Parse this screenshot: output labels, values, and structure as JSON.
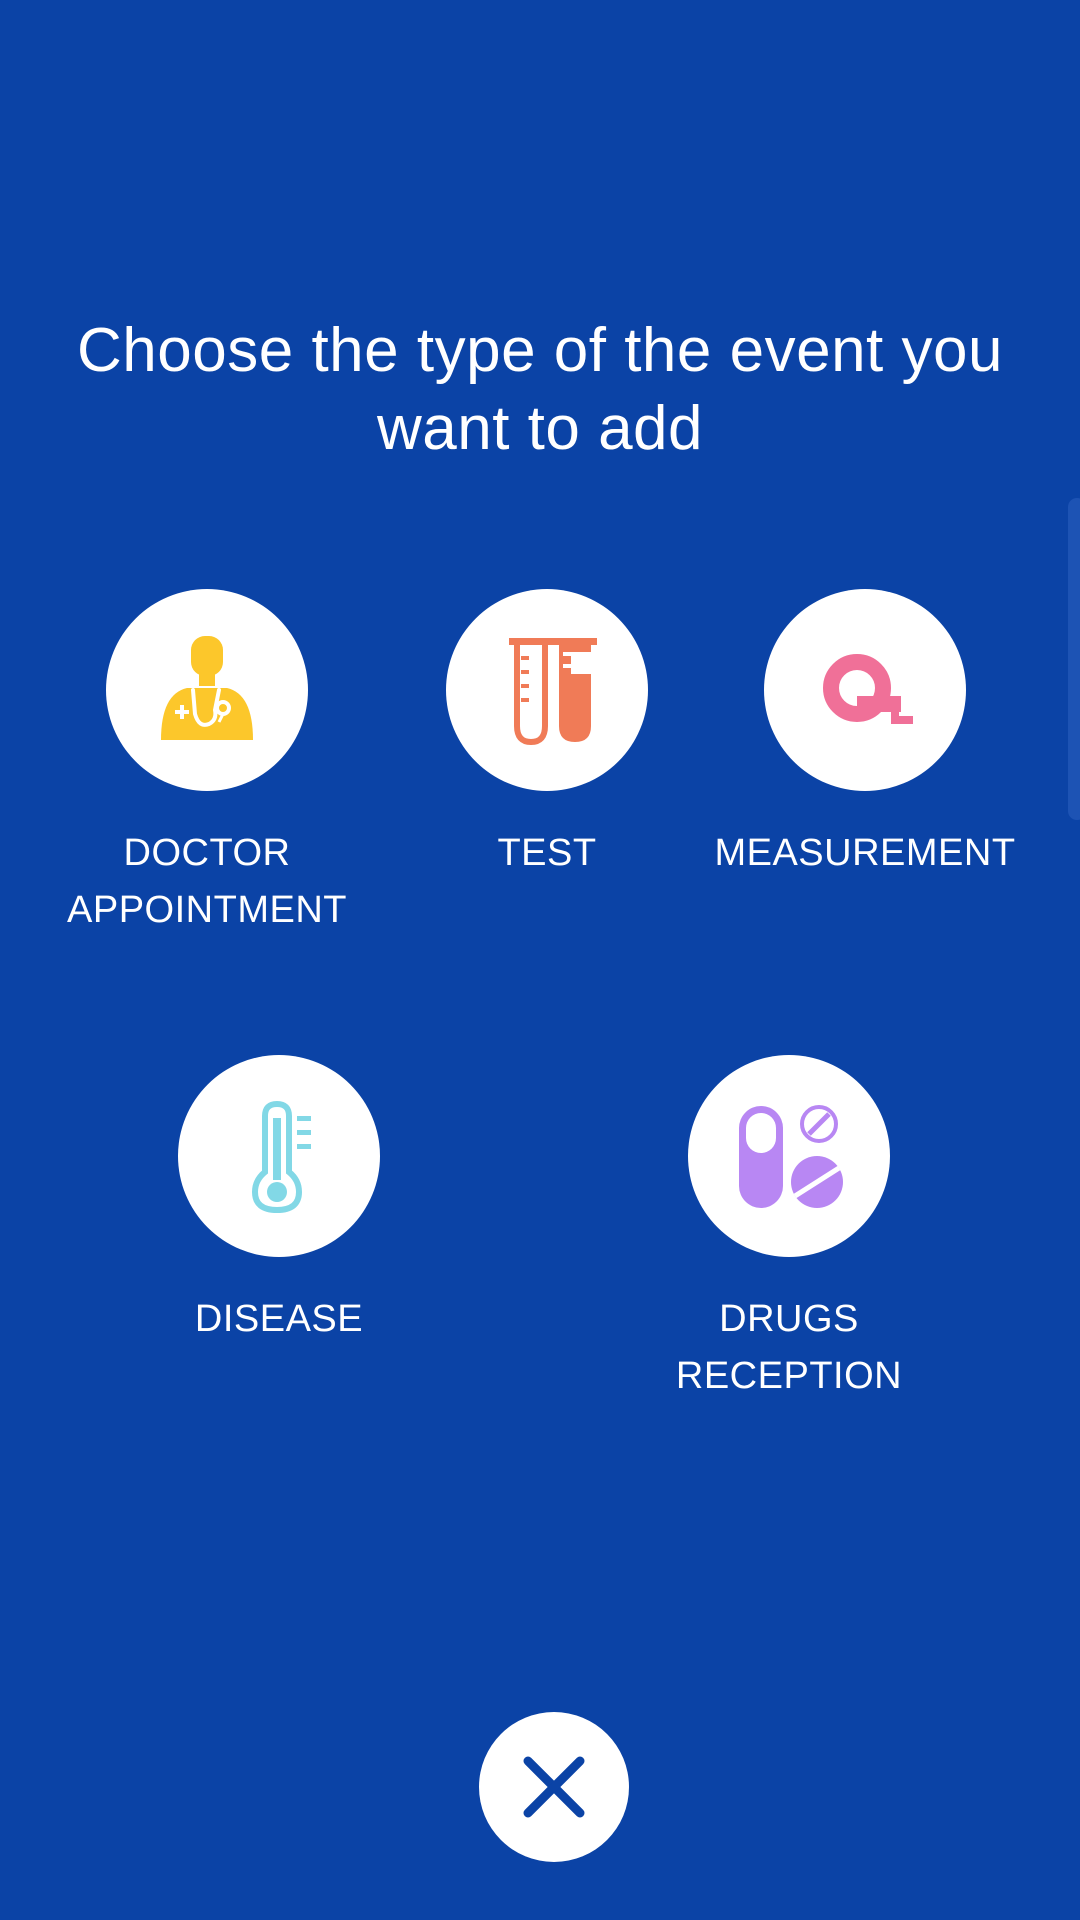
{
  "dialog": {
    "title": "Choose the type of the event you want to add"
  },
  "options": [
    {
      "id": "doctor",
      "label_lines": [
        "DOCTOR",
        "APPOINTMENT"
      ],
      "icon": "doctor-icon",
      "color": "#fcc72b"
    },
    {
      "id": "test",
      "label_lines": [
        "TEST"
      ],
      "icon": "test-tubes-icon",
      "color": "#f07b57"
    },
    {
      "id": "measurement",
      "label_lines": [
        "MEASUREMENT"
      ],
      "icon": "tape-measure-icon",
      "color": "#f07098"
    },
    {
      "id": "disease",
      "label_lines": [
        "DISEASE"
      ],
      "icon": "thermometer-icon",
      "color": "#82d8e6"
    },
    {
      "id": "drugs",
      "label_lines": [
        "DRUGS",
        "RECEPTION"
      ],
      "icon": "pills-icon",
      "color": "#b887f3"
    }
  ],
  "close_button": {
    "icon": "close-icon",
    "color": "#0b43a6"
  },
  "colors": {
    "background": "#0b43a6",
    "text": "#ffffff",
    "circle": "#ffffff"
  }
}
